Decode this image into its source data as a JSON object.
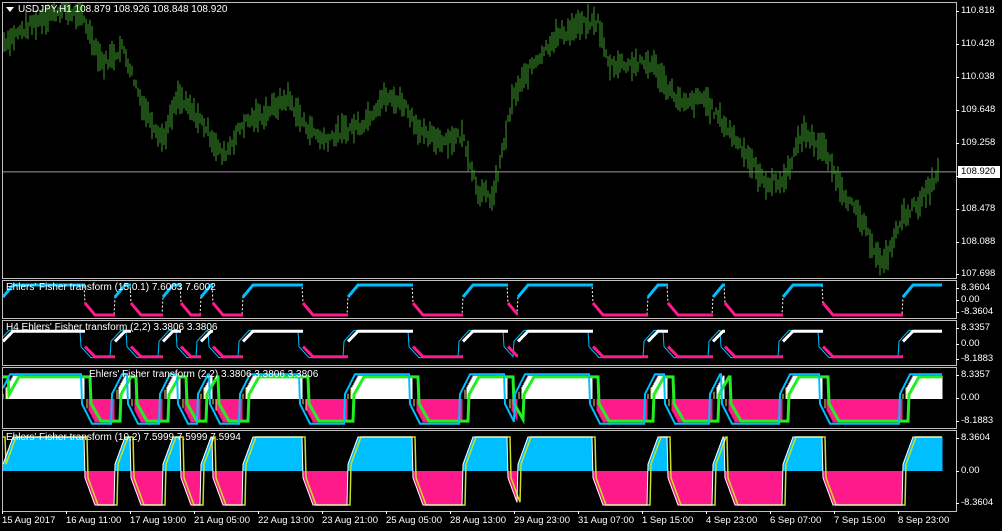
{
  "main_chart": {
    "symbol_label": "USDJPY,H1",
    "ohlc": "108.879 108.926 108.848 108.920",
    "current_price": "108.920",
    "price_ticks": [
      "110.818",
      "110.428",
      "110.038",
      "109.648",
      "109.258",
      "108.868",
      "108.478",
      "108.088",
      "107.698"
    ],
    "bar_color": "#3c9a2a"
  },
  "indicators": [
    {
      "label": "Ehlers' Fisher transform (15,0.1) 7.6003 7.6002",
      "ticks": [
        "8.3604",
        "0.00",
        "-8.3604"
      ]
    },
    {
      "label": "H4 Ehlers' Fisher transform (2,2) 3.3806 3.3806",
      "ticks": [
        "8.3357",
        "0.00",
        "-8.1883"
      ]
    },
    {
      "label": "Ehlers' Fisher transform (2,2) 3.3806 3.3806 3.3806",
      "ticks": [
        "8.3357",
        "0.00",
        "-8.1883"
      ]
    },
    {
      "label": "Ehlers' Fisher transform (10,2) 7.5999 7.5999 7.5994",
      "ticks": [
        "8.3604",
        "0.00",
        "-8.3604"
      ]
    }
  ],
  "time_labels": [
    "15 Aug 2017",
    "16 Aug 11:00",
    "17 Aug 19:00",
    "21 Aug 05:00",
    "22 Aug 13:00",
    "23 Aug 21:00",
    "25 Aug 05:00",
    "28 Aug 13:00",
    "29 Aug 23:00",
    "31 Aug 07:00",
    "1 Sep 15:00",
    "4 Sep 23:00",
    "6 Sep 07:00",
    "7 Sep 15:00",
    "8 Sep 23:00"
  ],
  "colors": {
    "up": "#00bfff",
    "down": "#ff1a8c",
    "white": "#ffffff",
    "green": "#22ee22",
    "frame": "#c0c0c0"
  }
}
